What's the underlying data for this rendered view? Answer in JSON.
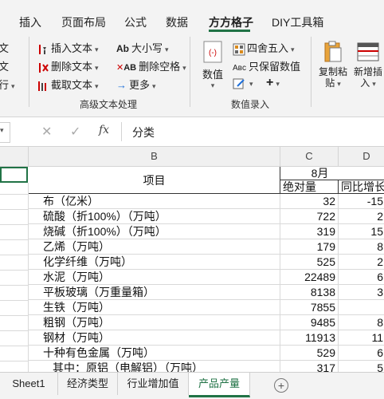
{
  "ribbon_tabs": [
    "插入",
    "页面布局",
    "公式",
    "数据",
    "方方格子",
    "DIY工具箱"
  ],
  "ribbon": {
    "left_partial": [
      "文",
      "文",
      "行"
    ],
    "text_group": {
      "items": [
        "插入文本",
        "删除文本",
        "截取文本",
        "大小写",
        "删除空格",
        "更多"
      ],
      "label": "高级文本处理"
    },
    "number_group": {
      "round_label": "四舍五入",
      "keep_values_label": "只保留数值",
      "numbers_label": "数值",
      "label": "数值录入"
    },
    "copy_paste_label": [
      "复制粘",
      "贴"
    ],
    "new_insert_label": [
      "新增插",
      "入"
    ]
  },
  "formula_bar": {
    "fx": "fx",
    "value": "分类"
  },
  "grid": {
    "columns": [
      "B",
      "C",
      "D"
    ],
    "header": {
      "item": "项目",
      "month": "8月",
      "abs": "绝对量",
      "yoy": "同比增长"
    },
    "rows": [
      {
        "label": "布（亿米）",
        "value": "32",
        "yoy": "-15"
      },
      {
        "label": "硫酸（折100%）（万吨）",
        "value": "722",
        "yoy": "2"
      },
      {
        "label": "烧碱（折100%）（万吨）",
        "value": "319",
        "yoy": "15"
      },
      {
        "label": "乙烯（万吨）",
        "value": "179",
        "yoy": "8"
      },
      {
        "label": "化学纤维（万吨）",
        "value": "525",
        "yoy": "2"
      },
      {
        "label": "水泥（万吨）",
        "value": "22489",
        "yoy": "6"
      },
      {
        "label": "平板玻璃（万重量箱）",
        "value": "8138",
        "yoy": "3"
      },
      {
        "label": "生铁（万吨）",
        "value": "7855",
        "yoy": ""
      },
      {
        "label": "粗钢（万吨）",
        "value": "9485",
        "yoy": "8"
      },
      {
        "label": "钢材（万吨）",
        "value": "11913",
        "yoy": "11"
      },
      {
        "label": "十种有色金属（万吨）",
        "value": "529",
        "yoy": "6"
      },
      {
        "label": "其中：原铝（电解铝）（万吨）",
        "value": "317",
        "yoy": "5"
      }
    ]
  },
  "sheet_tabs": [
    "Sheet1",
    "经济类型",
    "行业增加值",
    "产品产量"
  ],
  "active_sheet": "产品产量",
  "colors": {
    "accent": "#217346"
  }
}
